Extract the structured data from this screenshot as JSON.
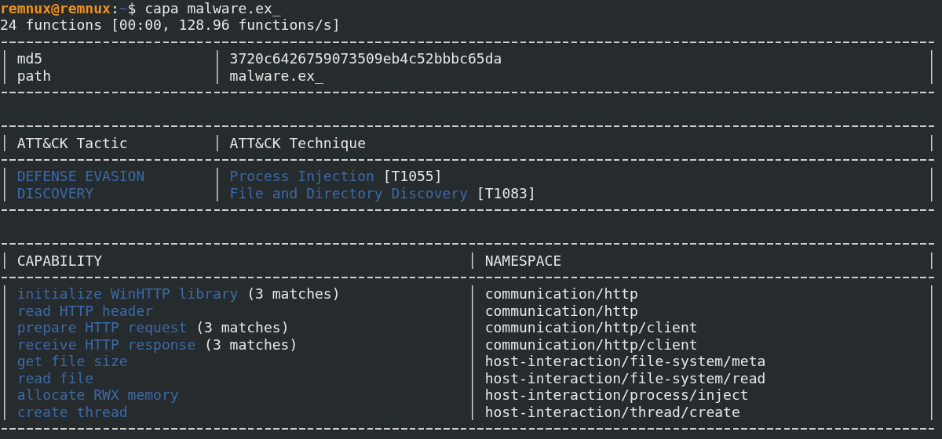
{
  "terminal": {
    "prompt": {
      "user_host": "remnux@remnux",
      "separator": ":",
      "path": "~",
      "symbol": "$",
      "command": "capa malware.ex_"
    },
    "output": "24 functions [00:00, 128.96 functions/s]",
    "tables": [
      {
        "kind": "info",
        "rows": [
          {
            "key": "md5",
            "value": "3720c6426759073509eb4c52bbbc65da"
          },
          {
            "key": "path",
            "value": "malware.ex_"
          }
        ]
      },
      {
        "kind": "attack",
        "columns": [
          "ATT&CK Tactic",
          "ATT&CK Technique"
        ],
        "rows": [
          {
            "tactic": "DEFENSE EVASION",
            "technique": "Process Injection",
            "technique_id": "[T1055]"
          },
          {
            "tactic": "DISCOVERY",
            "technique": "File and Directory Discovery",
            "technique_id": "[T1083]"
          }
        ]
      },
      {
        "kind": "capabilities",
        "columns": [
          "CAPABILITY",
          "NAMESPACE"
        ],
        "rows": [
          {
            "capability": "initialize WinHTTP library",
            "matches": "(3 matches)",
            "namespace": "communication/http"
          },
          {
            "capability": "read HTTP header",
            "namespace": "communication/http"
          },
          {
            "capability": "prepare HTTP request",
            "matches": "(3 matches)",
            "namespace": "communication/http/client"
          },
          {
            "capability": "receive HTTP response",
            "matches": "(3 matches)",
            "namespace": "communication/http/client"
          },
          {
            "capability": "get file size",
            "namespace": "host-interaction/file-system/meta"
          },
          {
            "capability": "read file",
            "namespace": "host-interaction/file-system/read"
          },
          {
            "capability": "allocate RWX memory",
            "namespace": "host-interaction/process/inject"
          },
          {
            "capability": "create thread",
            "namespace": "host-interaction/thread/create"
          }
        ]
      }
    ]
  }
}
